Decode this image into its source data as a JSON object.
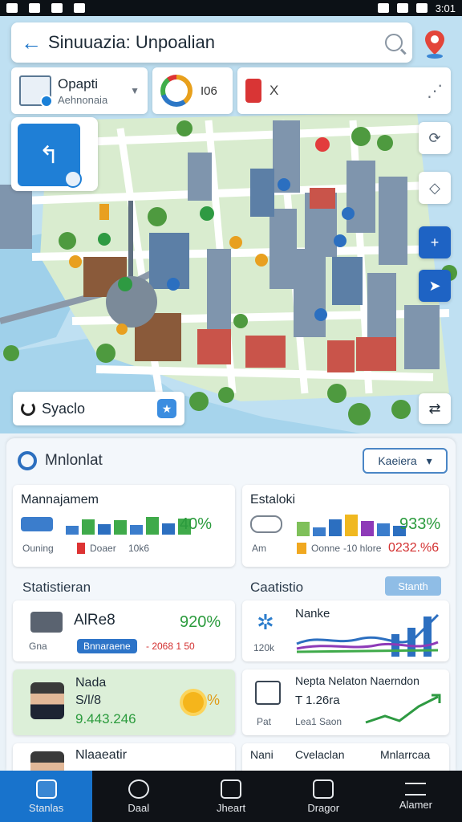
{
  "status": {
    "time": "3:01"
  },
  "header": {
    "back_icon": "arrow-left-icon",
    "title": "Sinuuazia: Unpoalian",
    "search_icon": "search-icon"
  },
  "filters": {
    "first": {
      "name": "Opapti",
      "sub": "Aehnonaia"
    },
    "second": {
      "value": "I06"
    },
    "third": {
      "value": "X"
    }
  },
  "map": {
    "place_label": "Syaclo"
  },
  "panel": {
    "title": "Mnlonlat",
    "action_label": "Kaeiera",
    "card1": {
      "title": "Mannajamem",
      "value": "40%",
      "meta1": "Ouning",
      "meta2": "Doaer",
      "meta3": "10k6",
      "bars": [
        0.45,
        0.8,
        0.55,
        0.75,
        0.5,
        0.9,
        0.6,
        0.85
      ]
    },
    "card2": {
      "title": "Estaloki",
      "value": "933%",
      "meta1": "Am",
      "meta2": "Oonne",
      "meta3": "-10 hlore",
      "meta4": "0232.%6",
      "bars": [
        0.55,
        0.35,
        0.65,
        0.85,
        0.6,
        0.5,
        0.4
      ]
    },
    "section_left": "Statistieran",
    "section_right": "Caatistio",
    "section_button": "Stanth",
    "card3": {
      "title": "AlRe8",
      "value": "920%",
      "meta1": "Gna",
      "chip": "Bnnaraene",
      "meta2": "- 2068 1 50"
    },
    "card4": {
      "title": "Nanke",
      "meta1": "120k"
    },
    "card5": {
      "title": "Nada",
      "sub": "S/l/8",
      "value": "9.443.246",
      "pct": "%"
    },
    "card6": {
      "title": "Nepta Nelaton Naerndon",
      "value": "T 1.26ra",
      "meta1": "Pat",
      "meta2": "Lea1 Saon"
    },
    "row7": {
      "title": "Nlaaeatir",
      "left": "Nani",
      "mid": "Cvelaclan",
      "right": "Mnlarrcaa"
    }
  },
  "nav": {
    "tabs": [
      {
        "label": "Stanlas",
        "icon": "home-icon"
      },
      {
        "label": "Daal",
        "icon": "person-icon"
      },
      {
        "label": "Jheart",
        "icon": "dashboard-icon"
      },
      {
        "label": "Dragor",
        "icon": "alert-icon"
      },
      {
        "label": "Alamer",
        "icon": "menu-icon"
      }
    ]
  }
}
